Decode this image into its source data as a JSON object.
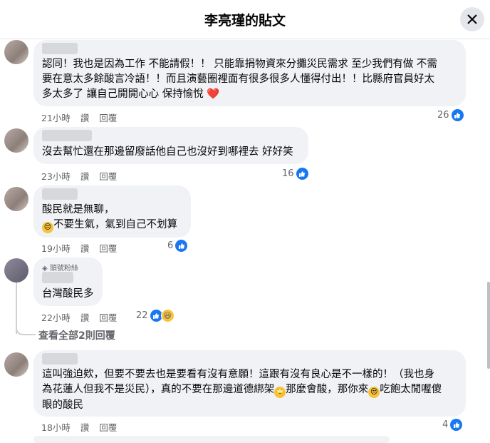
{
  "header": {
    "title": "李亮瑾的貼文"
  },
  "comments": [
    {
      "text_lines": [
        "認同！我也是因為工作 不能請假！！ 只能靠捐物資來分攤災民需求 至少我們有做 不需",
        "要在意太多餘酸言冷語！！而且演藝圈裡面有很多很多人懂得付出！！比縣府官員好太",
        "多太多了 讓自己開開心心 保持愉悅"
      ],
      "heart": "❤️",
      "time": "21小時",
      "like": "讚",
      "reply": "回覆",
      "count": "26"
    },
    {
      "text_lines": [
        "沒去幫忙還在那邊留廢話他自己也沒好到哪裡去 好好笑"
      ],
      "time": "23小時",
      "like": "讚",
      "reply": "回覆",
      "count": "16"
    },
    {
      "text_lines": [
        "酸民就是無聊，",
        "不要生氣，氣到自己不划算"
      ],
      "time": "19小時",
      "like": "讚",
      "reply": "回覆",
      "count": "6"
    },
    {
      "badge": "頭號粉絲",
      "text_lines": [
        "台灣酸民多"
      ],
      "time": "22小時",
      "like": "讚",
      "reply": "回覆",
      "count": "22"
    },
    {
      "text_lines": [
        "這叫強迫欸，但要不要去也是要看有沒有意願！這跟有沒有良心是不一樣的！（我也身",
        "為花蓮人但我不是災民），真的不要在那邊道德綁架",
        "那麼會酸，那你來",
        "吃飽太閒喔傻",
        "眼的酸民"
      ],
      "time": "18小時",
      "like": "讚",
      "reply": "回覆",
      "count": "4"
    }
  ],
  "view_replies": "查看全部2則回覆",
  "icons": {
    "close": "close-icon",
    "like": "like-icon",
    "haha": "haha-icon"
  }
}
